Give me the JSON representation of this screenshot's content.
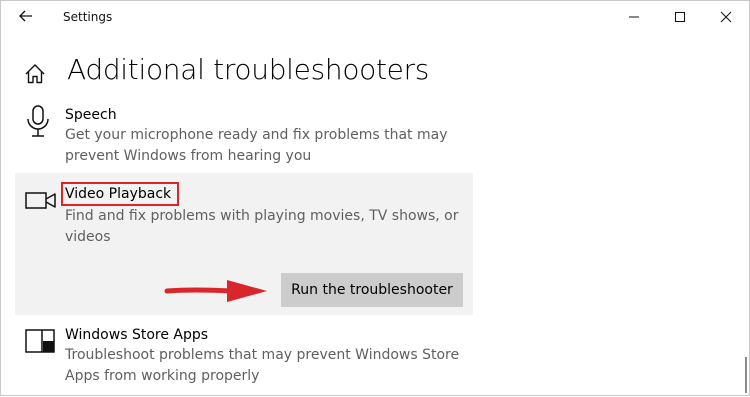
{
  "window": {
    "title": "Settings"
  },
  "page": {
    "title": "Additional troubleshooters"
  },
  "items": [
    {
      "icon": "microphone-icon",
      "title": "Speech",
      "description": "Get your microphone ready and fix problems that may prevent Windows from hearing you"
    },
    {
      "icon": "video-camera-icon",
      "title": "Video Playback",
      "description": "Find and fix problems with playing movies, TV shows, or videos",
      "button_label": "Run the troubleshooter",
      "selected": true
    },
    {
      "icon": "store-app-icon",
      "title": "Windows Store Apps",
      "description": "Troubleshoot problems that may prevent Windows Store Apps from working properly"
    }
  ],
  "colors": {
    "highlight": "#d9262b",
    "selected_bg": "#f2f2f2",
    "button_bg": "#cccccc",
    "description_text": "#5f5f5f"
  }
}
